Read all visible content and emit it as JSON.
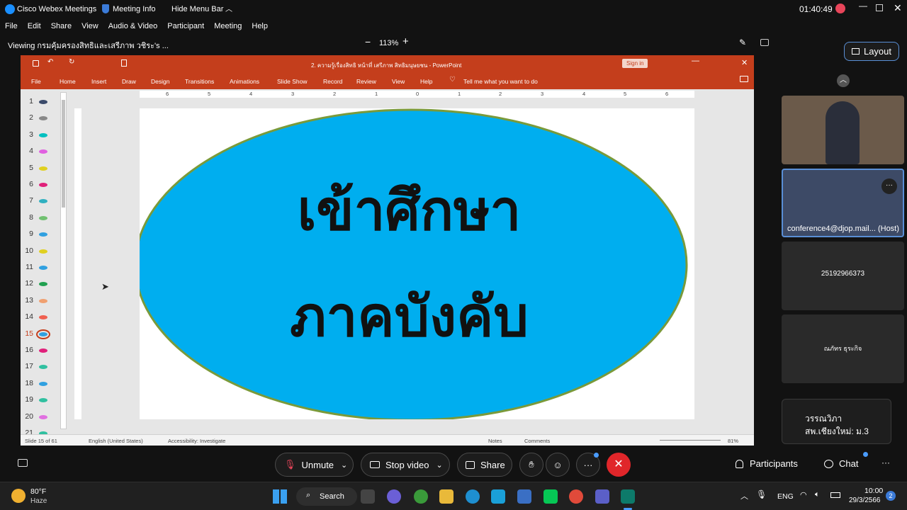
{
  "titlebar": {
    "app_name": "Cisco Webex Meetings",
    "meeting_info": "Meeting Info",
    "hide_menu": "Hide Menu Bar",
    "time": "01:40:49"
  },
  "menu": [
    "File",
    "Edit",
    "Share",
    "View",
    "Audio & Video",
    "Participant",
    "Meeting",
    "Help"
  ],
  "viewbar": {
    "viewing": "Viewing กรมคุ้มครองสิทธิและเสรีภาพ วชิระ's ...",
    "zoom": "113%"
  },
  "layout_label": "Layout",
  "ppt": {
    "title": "2. ความรู้เรื่องสิทธิ หน้าที่ เสรีภาพ สิทธิมนุษยชน  -  PowerPoint",
    "sign_in": "Sign in",
    "tabs": [
      "File",
      "Home",
      "Insert",
      "Draw",
      "Design",
      "Transitions",
      "Animations",
      "Slide Show",
      "Record",
      "Review",
      "View",
      "Help"
    ],
    "tell_me": "Tell me what you want to do",
    "ruler": [
      "6",
      "5",
      "4",
      "3",
      "2",
      "1",
      "0",
      "1",
      "2",
      "3",
      "4",
      "5",
      "6"
    ],
    "slides": [
      "1",
      "2",
      "3",
      "4",
      "5",
      "6",
      "7",
      "8",
      "9",
      "10",
      "11",
      "12",
      "13",
      "14",
      "15",
      "16",
      "17",
      "18",
      "19",
      "20",
      "21"
    ],
    "active_slide": "15",
    "slide_text_line1": "เข้าศึกษา",
    "slide_text_line2": "ภาคบังคับ",
    "status": {
      "slide_count": "Slide 15 of 61",
      "language": "English (United States)",
      "accessibility": "Accessibility: Investigate",
      "notes": "Notes",
      "comments": "Comments",
      "zoom": "81%"
    }
  },
  "participants": {
    "host_name": "conference4@djop.mail... (Host)",
    "tile3": "25192966373",
    "tile4": "ณภัทร ธุระกิจ",
    "caption_line1": "วรรณวิภา",
    "caption_line2": "สพ.เชียงใหม่: ม.3"
  },
  "controls": {
    "unmute": "Unmute",
    "stop_video": "Stop video",
    "share": "Share",
    "participants": "Participants",
    "chat": "Chat"
  },
  "taskbar": {
    "weather_temp": "80°F",
    "weather_desc": "Haze",
    "search": "Search",
    "lang": "ENG",
    "time": "10:00",
    "date": "29/3/2566",
    "notif": "2"
  },
  "colors": {
    "ppt_accent": "#c43e1c",
    "ellipse_fill": "#00aeef",
    "ellipse_stroke": "#7a9a3a",
    "end_button": "#e0262a",
    "record": "#e8455a"
  }
}
